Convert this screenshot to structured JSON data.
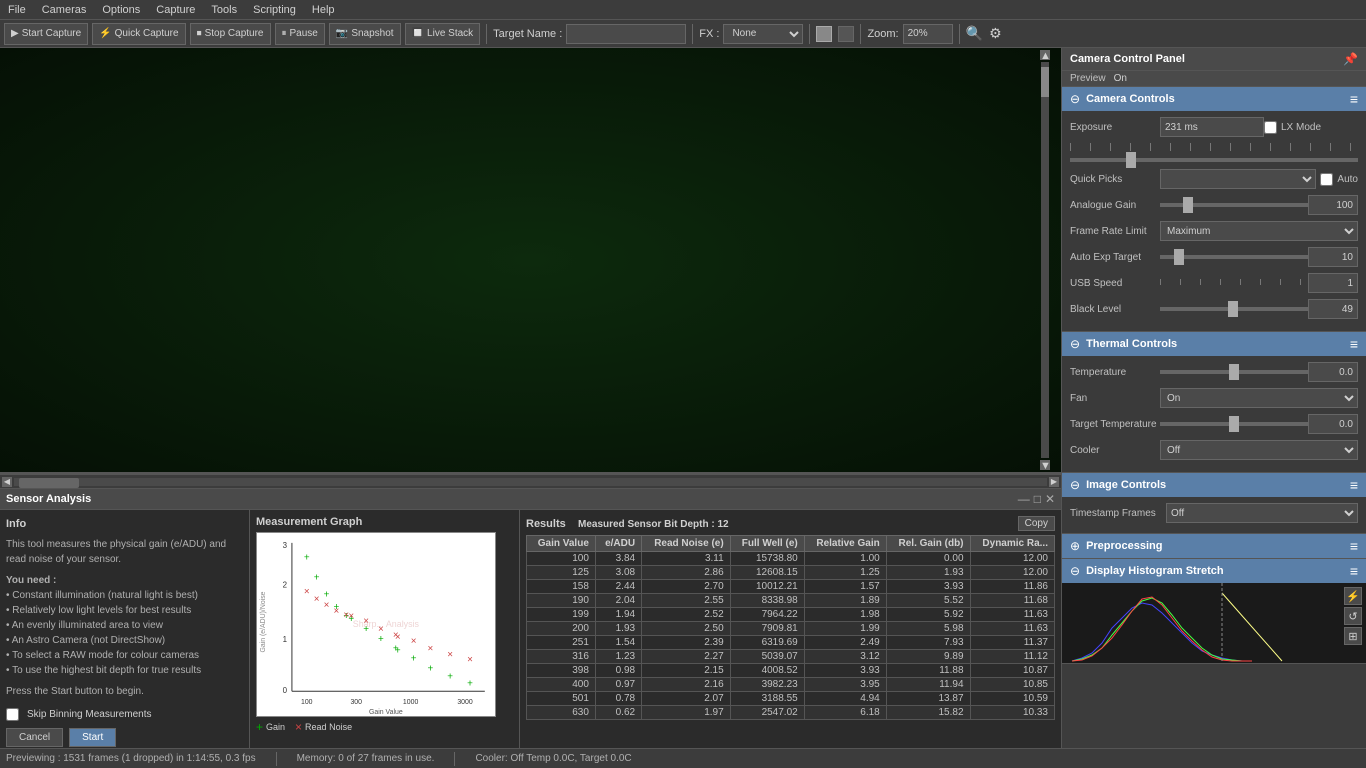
{
  "menubar": {
    "items": [
      "File",
      "Cameras",
      "Options",
      "Capture",
      "Tools",
      "Scripting",
      "Help"
    ]
  },
  "toolbar": {
    "start_capture": "Start Capture",
    "quick_capture": "Quick Capture",
    "stop_capture": "Stop Capture",
    "pause": "Pause",
    "snapshot": "Snapshot",
    "live_stack": "Live Stack",
    "target_name_label": "Target Name :",
    "target_name_value": "",
    "fx_label": "FX :",
    "fx_value": "None",
    "zoom_label": "Zoom:",
    "zoom_value": "20%"
  },
  "camera_control_panel": {
    "title": "Camera Control Panel",
    "preview_label": "Preview",
    "preview_value": "On",
    "sections": {
      "camera_controls": {
        "title": "Camera Controls",
        "exposure_label": "Exposure",
        "exposure_value": "231 ms",
        "lx_mode_label": "LX Mode",
        "quick_picks_label": "Quick Picks",
        "auto_label": "Auto",
        "analogue_gain_label": "Analogue Gain",
        "analogue_gain_value": "100",
        "frame_rate_limit_label": "Frame Rate Limit",
        "frame_rate_limit_value": "Maximum",
        "auto_exp_target_label": "Auto Exp Target",
        "auto_exp_target_value": "10",
        "usb_speed_label": "USB Speed",
        "usb_speed_value": "1",
        "black_level_label": "Black Level",
        "black_level_value": "49"
      },
      "thermal_controls": {
        "title": "Thermal Controls",
        "temperature_label": "Temperature",
        "temperature_value": "0.0",
        "fan_label": "Fan",
        "fan_value": "On",
        "target_temperature_label": "Target Temperature",
        "target_temperature_value": "0.0",
        "cooler_label": "Cooler",
        "cooler_value": "Off"
      },
      "image_controls": {
        "title": "Image Controls",
        "timestamp_frames_label": "Timestamp Frames",
        "timestamp_frames_value": "Off"
      },
      "preprocessing": {
        "title": "Preprocessing"
      },
      "display_histogram_stretch": {
        "title": "Display Histogram Stretch"
      }
    }
  },
  "sensor_analysis": {
    "panel_title": "Sensor Analysis",
    "info_title": "Info",
    "info_text": "This tool measures the physical gain (e/ADU) and read noise of your sensor.",
    "requirements_title": "You need :",
    "requirements": [
      "• Constant illumination (natural light is best)",
      "• Relatively low light levels for best results",
      "• An evenly illuminated area to view",
      "• An Astro Camera (not DirectShow)",
      "• To select a RAW mode for colour cameras",
      "• To use the highest bit depth for true results"
    ],
    "press_start": "Press the Start button to begin.",
    "skip_binning_label": "Skip Binning Measurements",
    "cancel_btn": "Cancel",
    "start_btn": "Start",
    "graph_title": "Measurement Graph",
    "legend_gain": "Gain",
    "legend_read_noise": "Read Noise",
    "graph_y_label": "Gain (e/ADU)/Noise",
    "graph_x_label": "Gain Value",
    "results_title": "Results",
    "measured_sensor_bit_depth": "Measured Sensor Bit Depth :  12",
    "copy_btn": "Copy",
    "table": {
      "headers": [
        "Gain Value",
        "e/ADU",
        "Read Noise (e)",
        "Full Well (e)",
        "Relative Gain",
        "Rel. Gain (db)",
        "Dynamic Ra..."
      ],
      "rows": [
        [
          "100",
          "3.84",
          "3.11",
          "15738.80",
          "1.00",
          "0.00",
          "12.00"
        ],
        [
          "125",
          "3.08",
          "2.86",
          "12608.15",
          "1.25",
          "1.93",
          "12.00"
        ],
        [
          "158",
          "2.44",
          "2.70",
          "10012.21",
          "1.57",
          "3.93",
          "11.86"
        ],
        [
          "190",
          "2.04",
          "2.55",
          "8338.98",
          "1.89",
          "5.52",
          "11.68"
        ],
        [
          "199",
          "1.94",
          "2.52",
          "7964.22",
          "1.98",
          "5.92",
          "11.63"
        ],
        [
          "200",
          "1.93",
          "2.50",
          "7909.81",
          "1.99",
          "5.98",
          "11.63"
        ],
        [
          "251",
          "1.54",
          "2.39",
          "6319.69",
          "2.49",
          "7.93",
          "11.37"
        ],
        [
          "316",
          "1.23",
          "2.27",
          "5039.07",
          "3.12",
          "9.89",
          "11.12"
        ],
        [
          "398",
          "0.98",
          "2.15",
          "4008.52",
          "3.93",
          "11.88",
          "10.87"
        ],
        [
          "400",
          "0.97",
          "2.16",
          "3982.23",
          "3.95",
          "11.94",
          "10.85"
        ],
        [
          "501",
          "0.78",
          "2.07",
          "3188.55",
          "4.94",
          "13.87",
          "10.59"
        ],
        [
          "630",
          "0.62",
          "1.97",
          "2547.02",
          "6.18",
          "15.82",
          "10.33"
        ]
      ]
    }
  },
  "status_bar": {
    "preview_info": "Previewing : 1531 frames (1 dropped) in 1:14:55, 0.3 fps",
    "memory_info": "Memory: 0 of 27 frames in use.",
    "cooler_info": "Cooler: Off Temp 0.0C, Target 0.0C"
  }
}
